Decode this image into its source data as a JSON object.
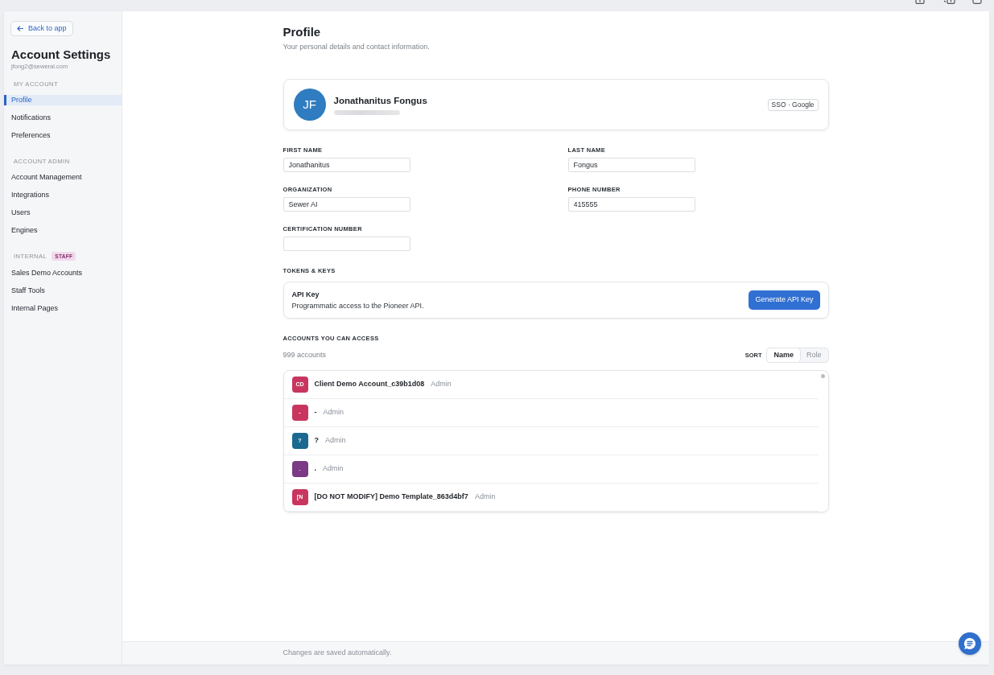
{
  "sidebar": {
    "back_button": "Back to app",
    "title": "Account Settings",
    "email": "jfong2@sewerai.com",
    "sections": [
      {
        "heading": "MY ACCOUNT",
        "items": [
          {
            "label": "Profile",
            "selected": true
          },
          {
            "label": "Notifications",
            "selected": false
          },
          {
            "label": "Preferences",
            "selected": false
          }
        ]
      },
      {
        "heading": "ACCOUNT ADMIN",
        "items": [
          {
            "label": "Account Management",
            "selected": false
          },
          {
            "label": "Integrations",
            "selected": false
          },
          {
            "label": "Users",
            "selected": false
          },
          {
            "label": "Engines",
            "selected": false
          }
        ]
      },
      {
        "heading": "INTERNAL",
        "badge": "STAFF",
        "items": [
          {
            "label": "Sales Demo Accounts",
            "selected": false
          },
          {
            "label": "Staff Tools",
            "selected": false
          },
          {
            "label": "Internal Pages",
            "selected": false
          }
        ]
      }
    ]
  },
  "page": {
    "title": "Profile",
    "subtitle": "Your personal details and contact information."
  },
  "profile_card": {
    "initials": "JF",
    "name": "Jonathanitus Fongus",
    "auth_badge": "SSO · Google"
  },
  "fields": [
    {
      "label": "FIRST NAME",
      "value": "Jonathanitus"
    },
    {
      "label": "LAST NAME",
      "value": "Fongus"
    },
    {
      "label": "ORGANIZATION",
      "value": "Sewer AI"
    },
    {
      "label": "PHONE NUMBER",
      "value": "415555"
    },
    {
      "label": "CERTIFICATION NUMBER"
    }
  ],
  "tokens": {
    "heading": "TOKENS & KEYS",
    "title": "API Key",
    "description": "Programmatic access to the Pioneer API.",
    "button": "Generate API Key"
  },
  "accounts": {
    "heading": "ACCOUNTS YOU CAN ACCESS",
    "count": "999 accounts",
    "sort_label": "SORT",
    "sort_options": [
      {
        "label": "Name",
        "selected": true
      },
      {
        "label": "Role",
        "selected": false
      }
    ],
    "rows": [
      {
        "initials": "CD",
        "name": "Client Demo Account_c39b1d08",
        "role": "Admin",
        "color": "#c8365f"
      },
      {
        "initials": "-",
        "name": "-",
        "role": "Admin",
        "color": "#c8365f"
      },
      {
        "initials": "?",
        "name": "?",
        "role": "Admin",
        "color": "#1b6890"
      },
      {
        "initials": ".",
        "name": ".",
        "role": "Admin",
        "color": "#7a3a84"
      },
      {
        "initials": "[N",
        "name": "[DO NOT MODIFY] Demo Template_863d4bf7",
        "role": "Admin",
        "color": "#c8365f"
      }
    ]
  },
  "footer": {
    "note": "Changes are saved automatically."
  }
}
